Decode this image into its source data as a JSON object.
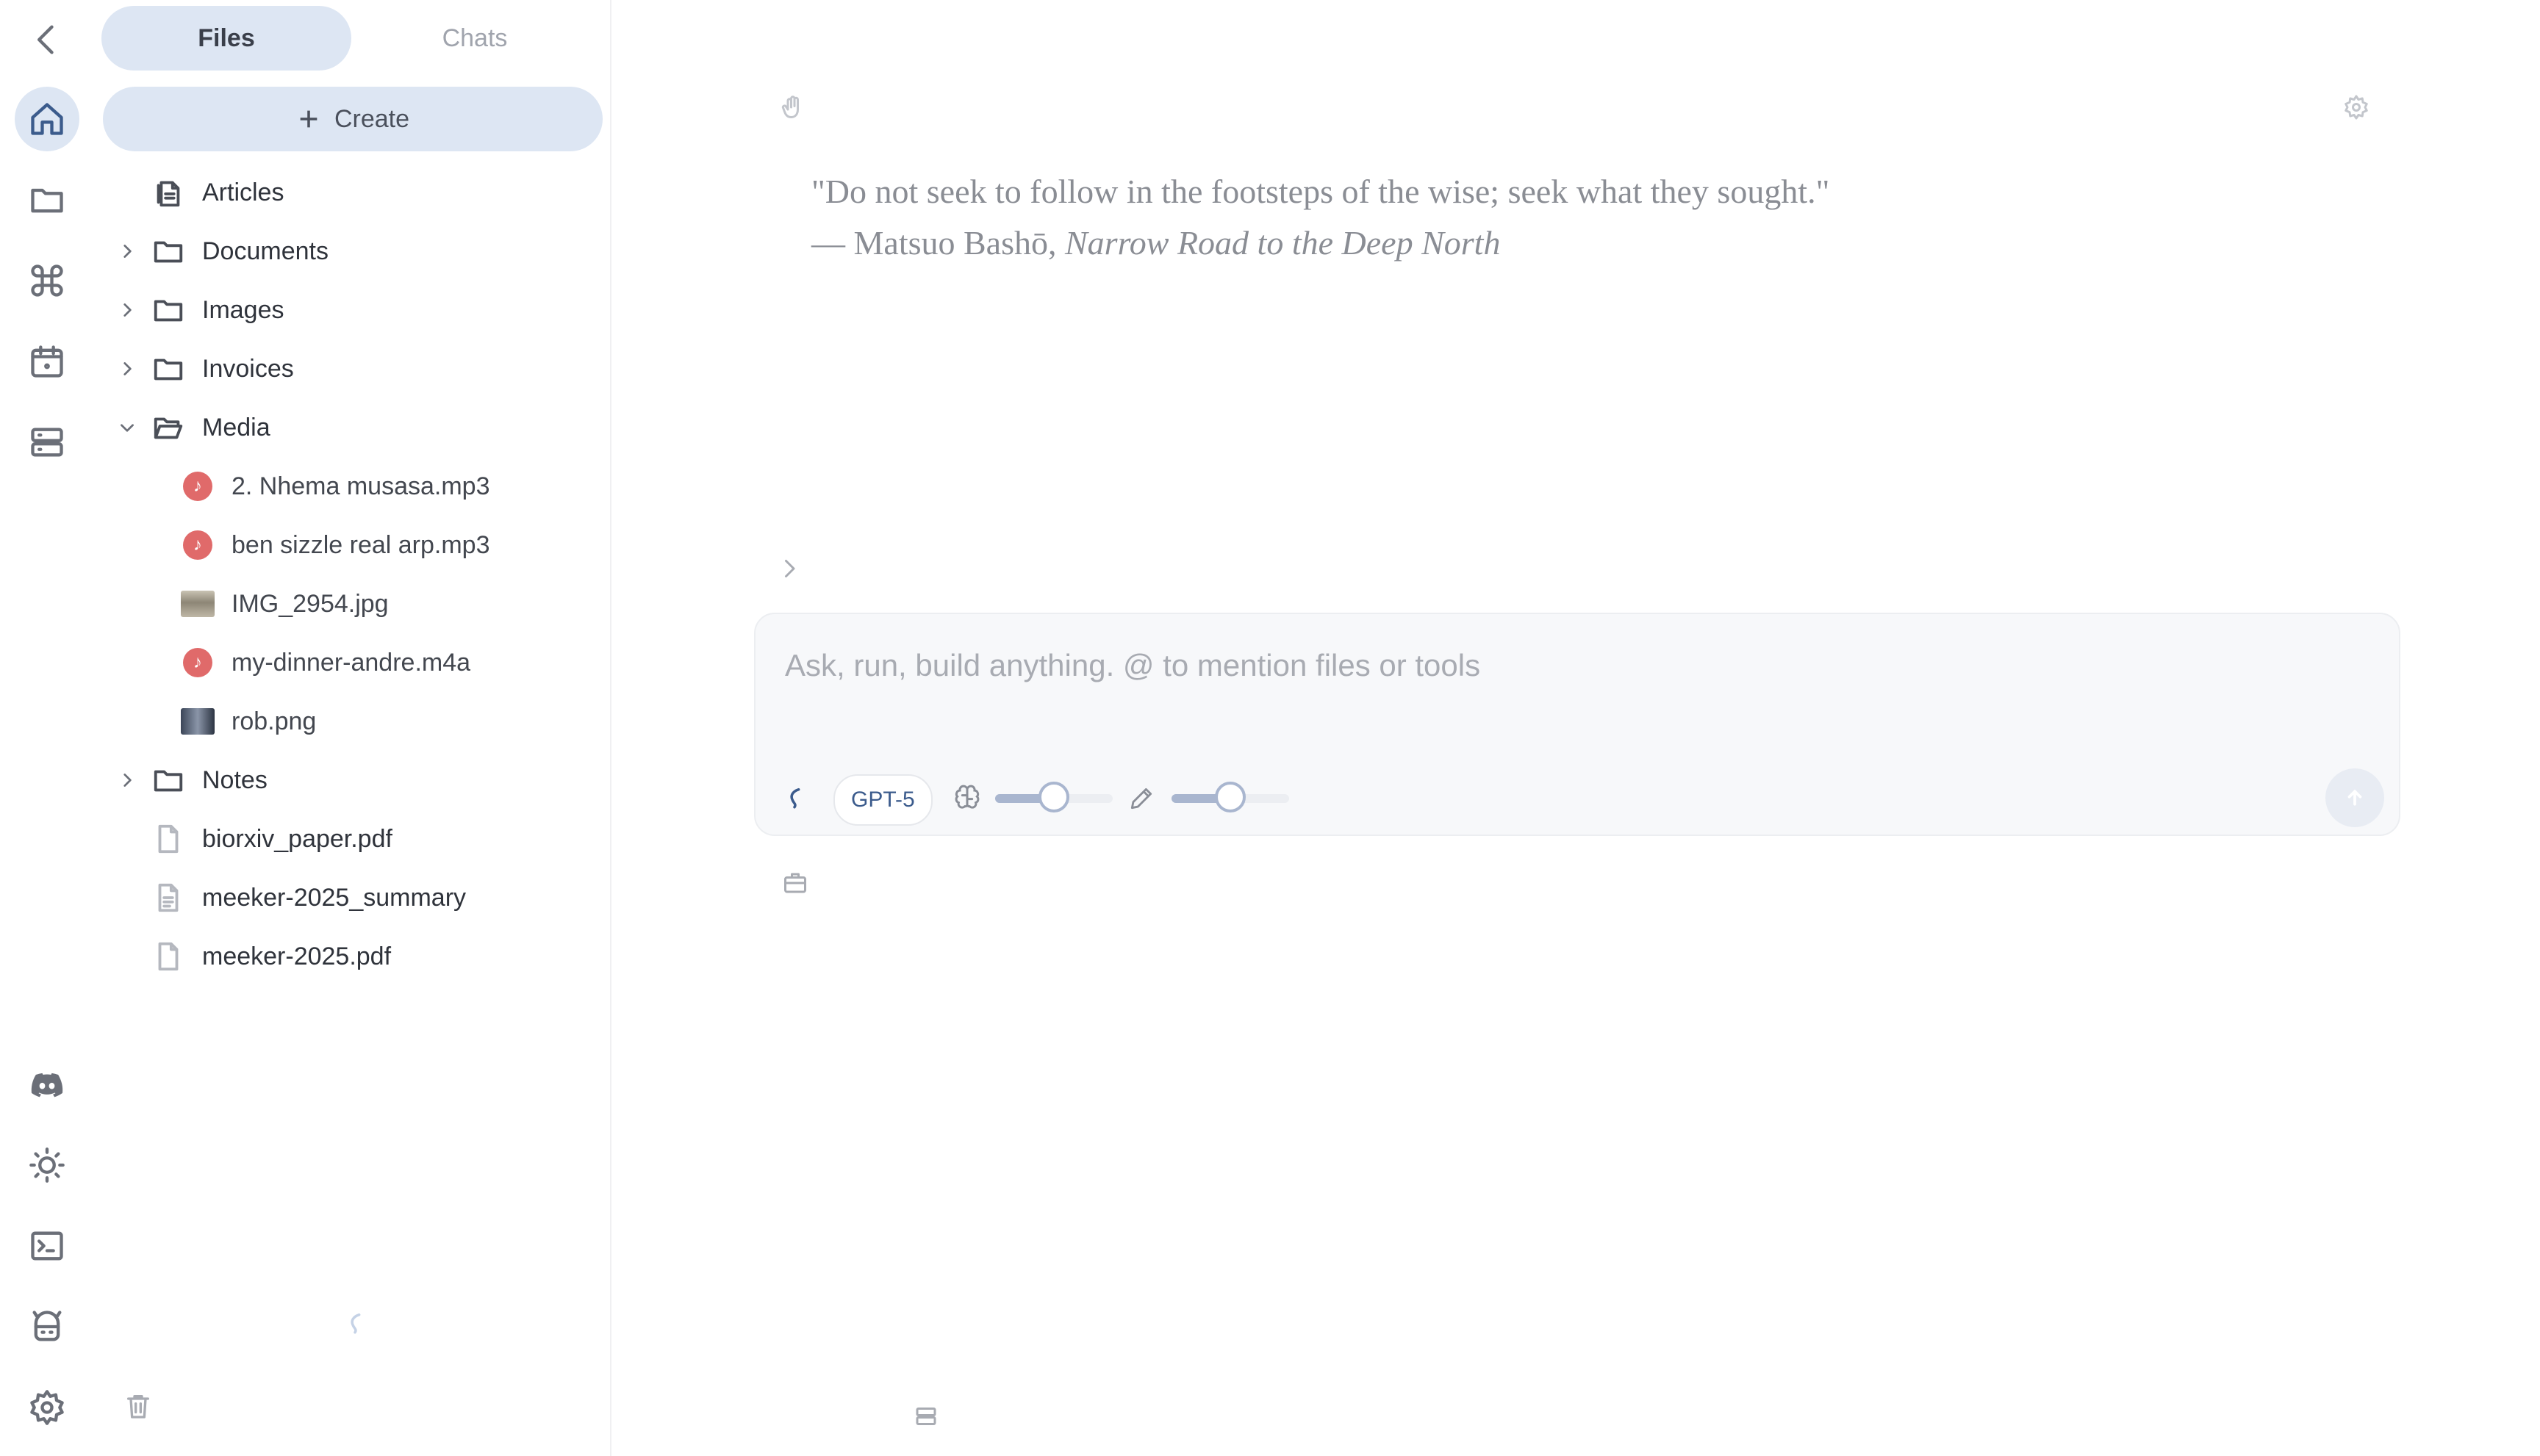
{
  "sidebar": {
    "tabs": [
      {
        "label": "Files",
        "active": true
      },
      {
        "label": "Chats",
        "active": false
      }
    ],
    "create_label": "Create",
    "tree": [
      {
        "label": "Articles",
        "type": "doc-group"
      },
      {
        "label": "Documents",
        "type": "folder",
        "expanded": false
      },
      {
        "label": "Images",
        "type": "folder",
        "expanded": false
      },
      {
        "label": "Invoices",
        "type": "folder",
        "expanded": false
      },
      {
        "label": "Media",
        "type": "folder",
        "expanded": true
      },
      {
        "label": "2. Nhema musasa.mp3",
        "type": "audio"
      },
      {
        "label": "ben sizzle real arp.mp3",
        "type": "audio"
      },
      {
        "label": "IMG_2954.jpg",
        "type": "image"
      },
      {
        "label": "my-dinner-andre.m4a",
        "type": "audio"
      },
      {
        "label": "rob.png",
        "type": "image"
      },
      {
        "label": "Notes",
        "type": "folder",
        "expanded": false
      },
      {
        "label": "biorxiv_paper.pdf",
        "type": "pdf"
      },
      {
        "label": "meeker-2025_summary",
        "type": "doc"
      },
      {
        "label": "meeker-2025.pdf",
        "type": "pdf"
      }
    ]
  },
  "main": {
    "quote_text": "\"Do not seek to follow in the footsteps of the wise; seek what they sought.\"",
    "quote_author": "— Matsuo Bashō, ",
    "quote_source": "Narrow Road to the Deep North",
    "composer": {
      "placeholder": "Ask, run, build anything. @ to mention files or tools",
      "model": "GPT-5",
      "thinking_level": 0.5,
      "edit_level": 0.5
    }
  },
  "colors": {
    "accent": "#dde6f3",
    "accent_text": "#3b5b8c",
    "audio_badge": "#e06a6a"
  },
  "icons": {
    "rail_top": [
      "back-icon",
      "home-icon",
      "folder-icon",
      "command-icon",
      "calendar-icon",
      "server-icon"
    ],
    "rail_bottom": [
      "discord-icon",
      "sun-icon",
      "terminal-icon",
      "bot-icon",
      "settings-icon"
    ]
  }
}
